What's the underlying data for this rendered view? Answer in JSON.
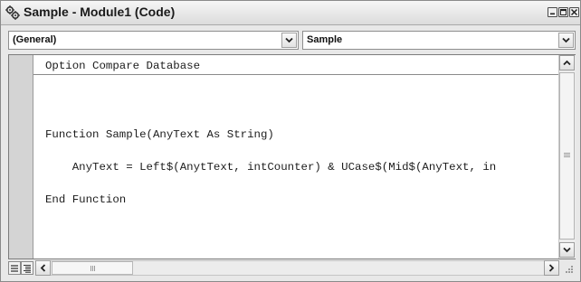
{
  "window": {
    "title": "Sample - Module1 (Code)",
    "icon": "code-module-icon",
    "controls": [
      "minimize-icon",
      "restore-icon",
      "close-icon"
    ]
  },
  "object_combo": {
    "value": "(General)"
  },
  "procedure_combo": {
    "value": "Sample"
  },
  "code": {
    "lines": [
      "Option Compare Database",
      "Function Sample(AnyText As String)",
      "    AnyText = Left$(AnytText, intCounter) & UCase$(Mid$(AnyText, in",
      "End Function"
    ]
  },
  "colors": {
    "window_background": "#e8e8e8",
    "code_background": "#ffffff",
    "margin_bar": "#d4d4d4",
    "code_text": "#1c1c1c"
  },
  "bottom": {
    "view_buttons": [
      "procedure-view-icon",
      "full-module-view-icon"
    ],
    "scroll_icons": [
      "scroll-left-icon",
      "scroll-right-icon",
      "scroll-up-icon",
      "scroll-down-icon"
    ]
  }
}
